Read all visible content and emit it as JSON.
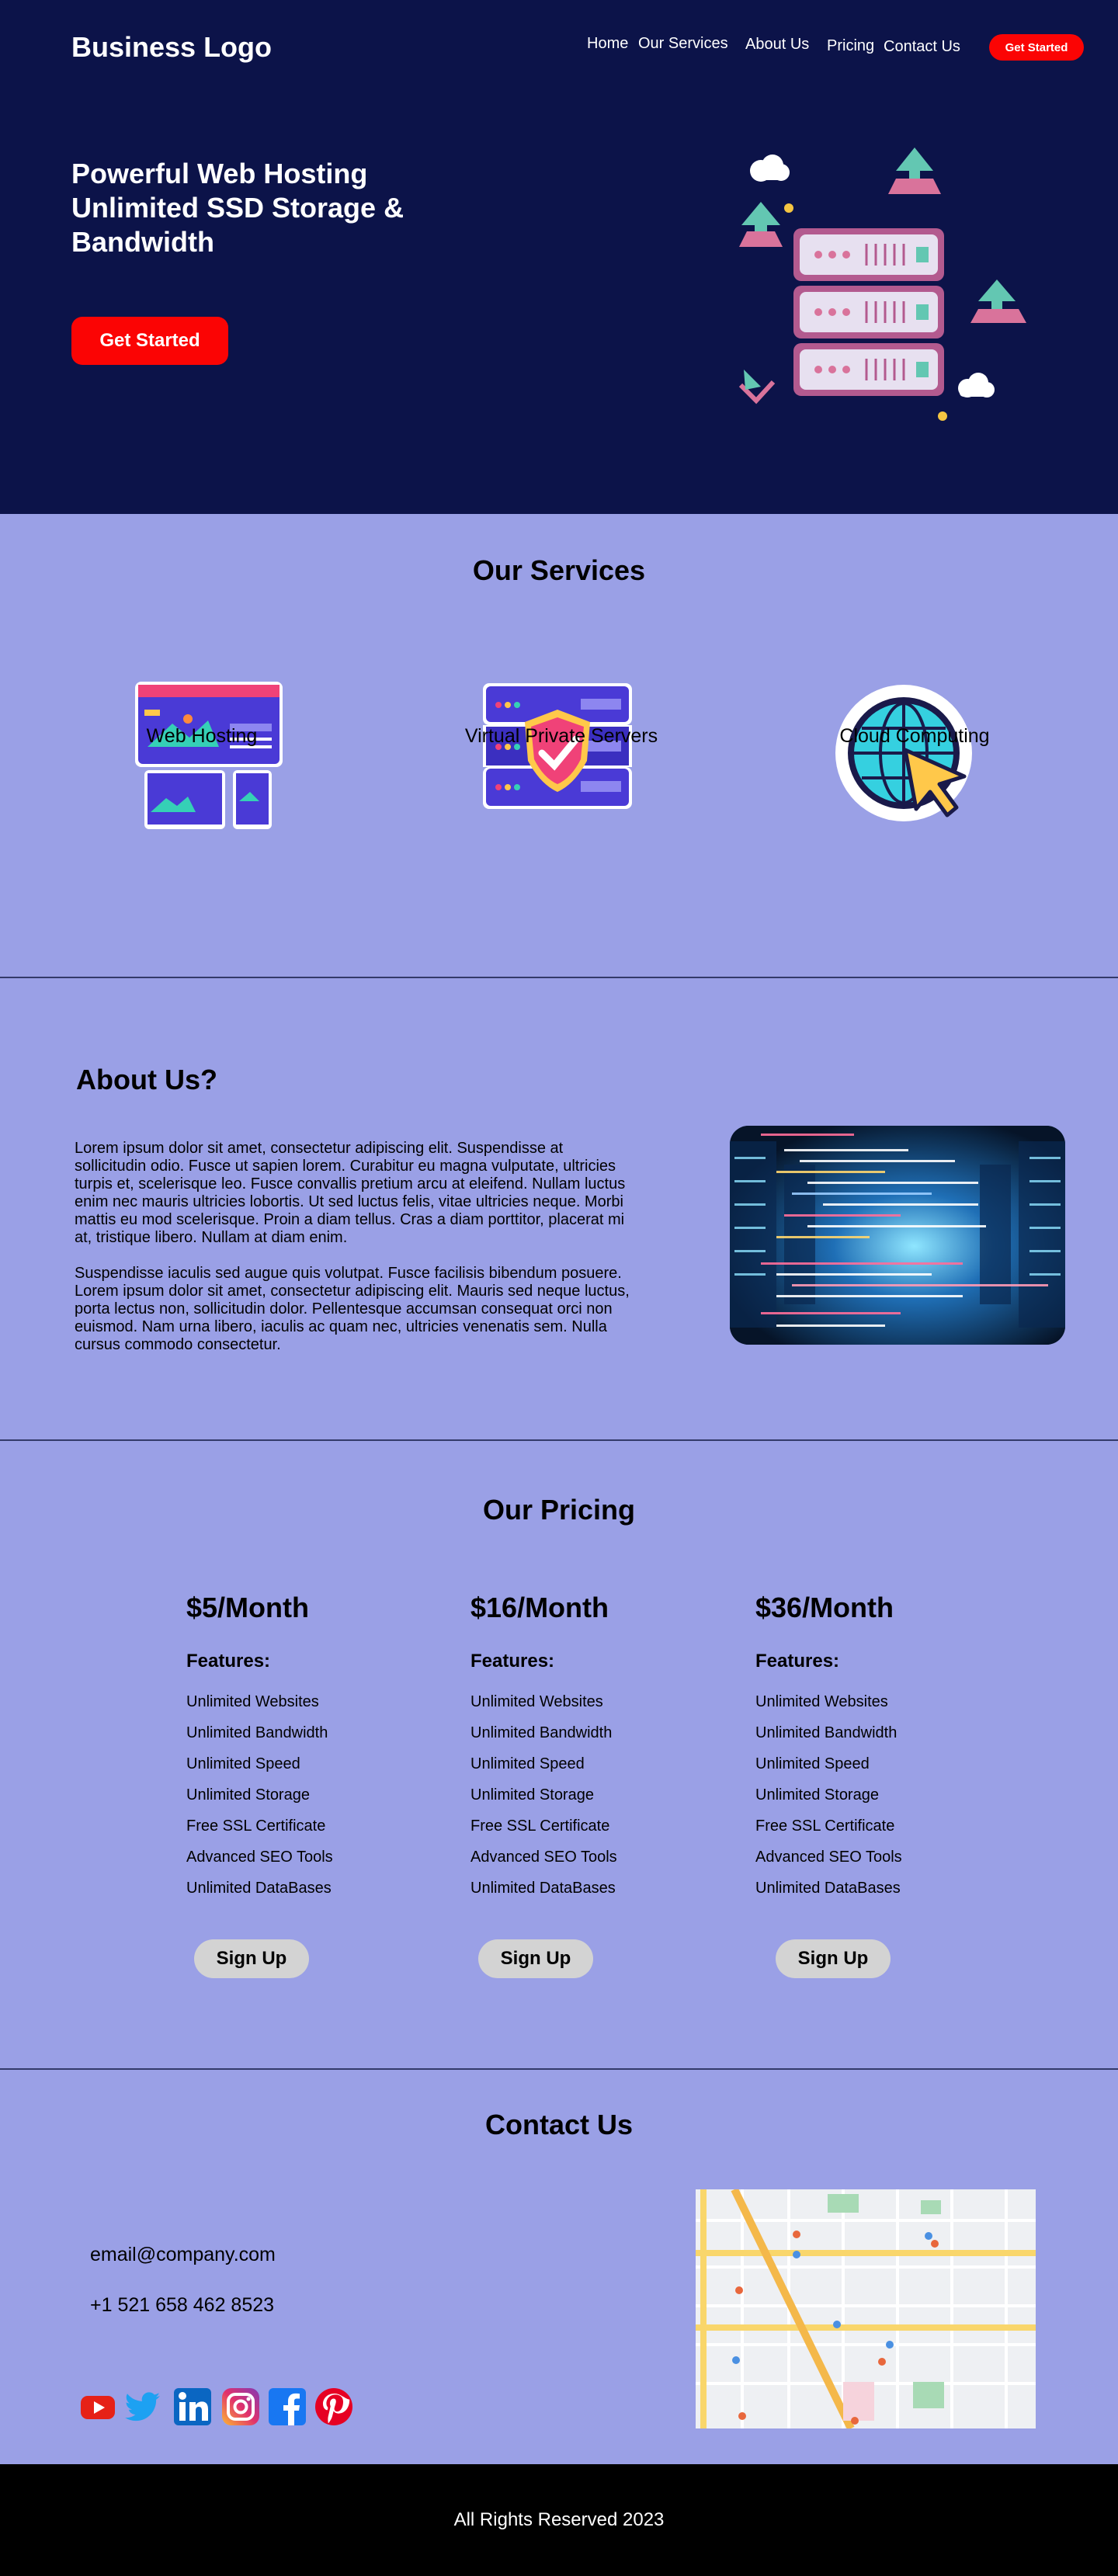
{
  "header": {
    "logo": "Business Logo",
    "nav": [
      "Home",
      "Our Services",
      "About Us",
      "Pricing",
      "Contact Us"
    ],
    "cta": "Get Started"
  },
  "hero": {
    "title": "Powerful Web Hosting Unlimited SSD Storage & Bandwidth",
    "cta": "Get Started"
  },
  "services": {
    "title": "Our Services",
    "items": [
      {
        "label": "Web Hosting",
        "icon": "responsive-devices-icon"
      },
      {
        "label": "Virtual Private Servers",
        "icon": "secure-server-icon"
      },
      {
        "label": "Cloud Computing",
        "icon": "globe-cursor-icon"
      }
    ]
  },
  "about": {
    "title": "About Us?",
    "paragraphs": [
      "Lorem ipsum dolor sit amet, consectetur adipiscing elit. Suspendisse at sollicitudin odio. Fusce ut sapien lorem. Curabitur eu magna vulputate, ultricies turpis et, scelerisque leo. Fusce convallis pretium arcu at eleifend. Nullam luctus enim nec mauris ultricies lobortis. Ut sed luctus felis, vitae ultricies neque. Morbi mattis eu mod scelerisque. Proin a diam tellus. Cras a diam porttitor, placerat mi at, tristique libero. Nullam at diam enim.",
      "Suspendisse iaculis sed augue quis volutpat. Fusce facilisis bibendum posuere. Lorem ipsum dolor sit amet, consectetur adipiscing elit. Mauris sed neque luctus, porta lectus non, sollicitudin dolor. Pellentesque accumsan consequat orci non euismod. Nam urna libero, iaculis ac quam nec, ultricies venenatis sem. Nulla cursus commodo consectetur."
    ]
  },
  "pricing": {
    "title": "Our Pricing",
    "features_label": "Features:",
    "signup": "Sign Up",
    "plans": [
      {
        "price": "$5/Month"
      },
      {
        "price": "$16/Month"
      },
      {
        "price": "$36/Month"
      }
    ],
    "features": [
      "Unlimited Websites",
      "Unlimited Bandwidth",
      "Unlimited Speed",
      "Unlimited Storage",
      "Free SSL Certificate",
      "Advanced SEO Tools",
      "Unlimited DataBases"
    ]
  },
  "contact": {
    "title": "Contact Us",
    "email": "email@company.com",
    "phone": "+1 521 658 462 8523",
    "social": [
      "youtube-icon",
      "twitter-icon",
      "linkedin-icon",
      "instagram-icon",
      "facebook-icon",
      "pinterest-icon"
    ]
  },
  "footer": {
    "text": "All Rights Reserved 2023"
  },
  "colors": {
    "hero_bg": "#0c1349",
    "page_bg": "#9aa0e6",
    "accent_red": "#fb0404",
    "footer_bg": "#000000",
    "button_gray": "#d3d3d3"
  }
}
